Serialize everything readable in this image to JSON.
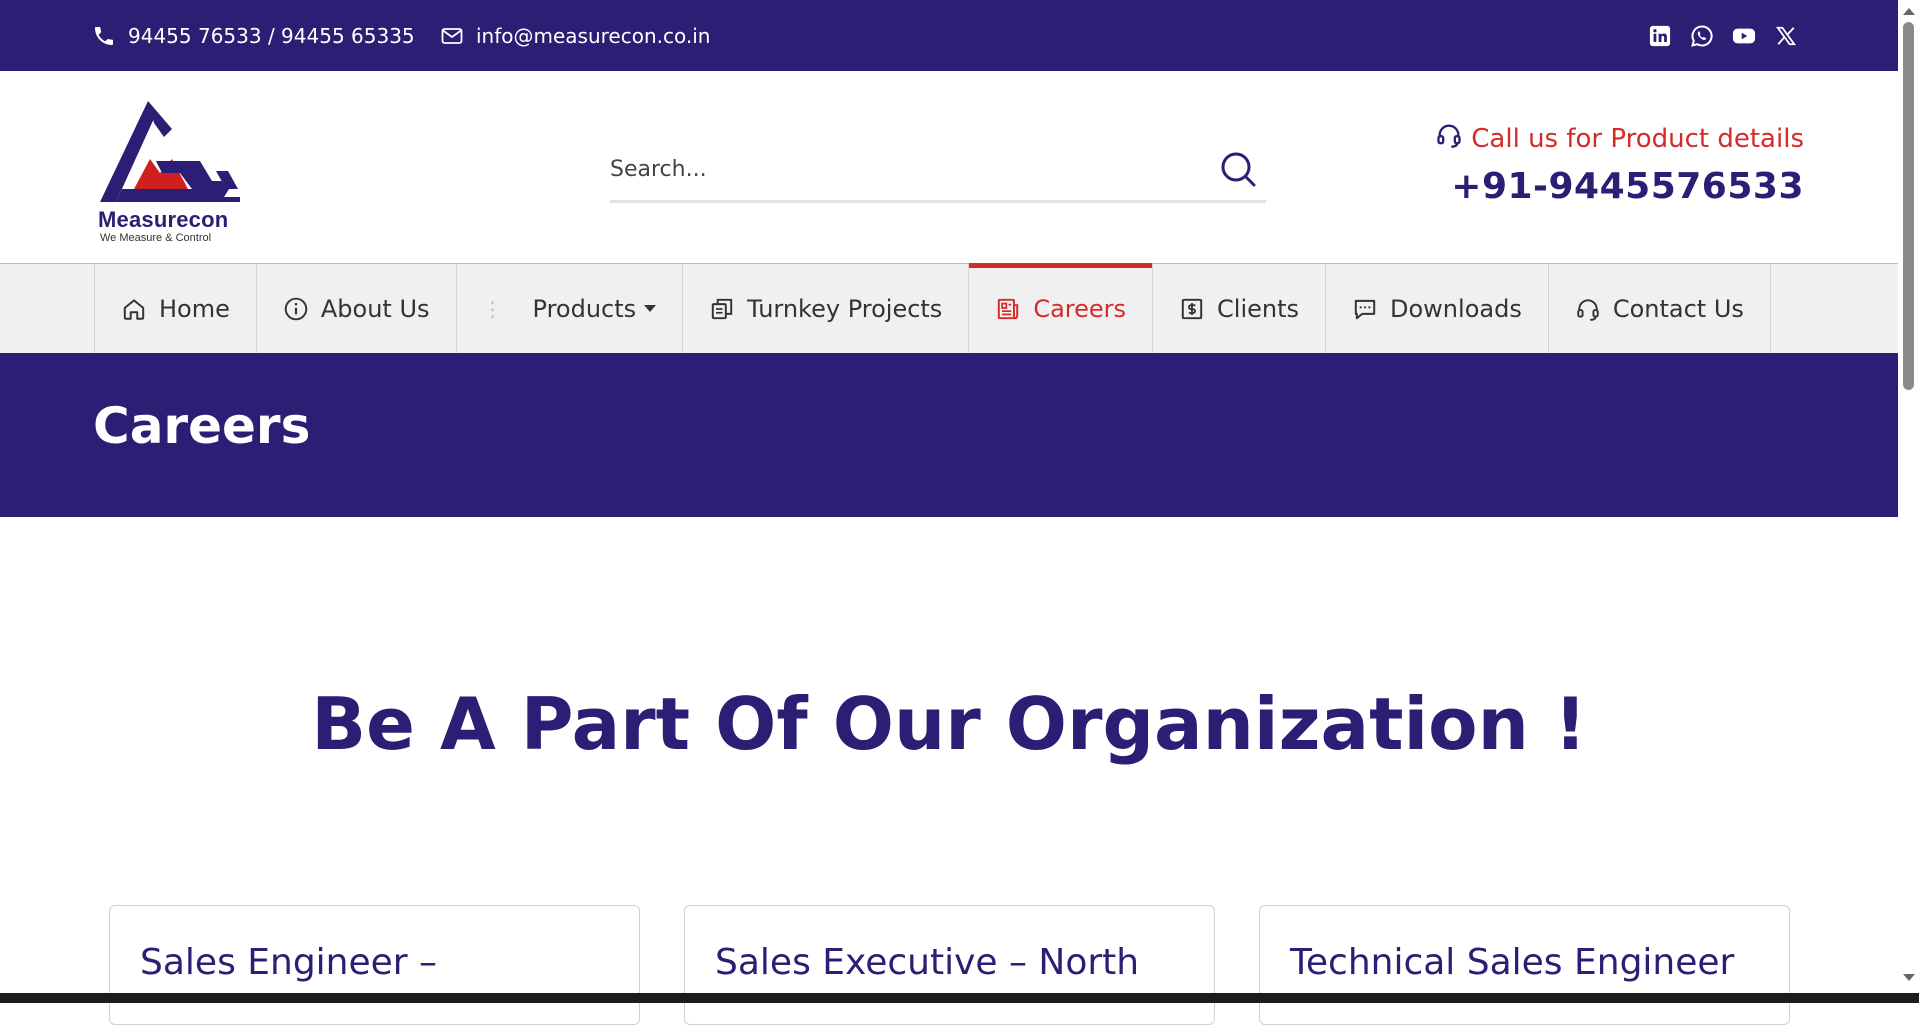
{
  "topbar": {
    "phone": "94455 76533 / 94455 65335",
    "email": "info@measurecon.co.in",
    "socials": [
      "linkedin-icon",
      "whatsapp-icon",
      "youtube-icon",
      "x-icon"
    ]
  },
  "logo": {
    "name": "Measurecon",
    "tagline": "We Measure & Control"
  },
  "search": {
    "placeholder": "Search..."
  },
  "callus": {
    "label": "Call us for Product details",
    "number": "+91-9445576533"
  },
  "nav": {
    "items": [
      {
        "label": "Home",
        "icon": "home-icon"
      },
      {
        "label": "About Us",
        "icon": "info-icon"
      },
      {
        "label": "Products",
        "icon": "dots-icon"
      },
      {
        "label": "Turnkey Projects",
        "icon": "copy-icon"
      },
      {
        "label": "Careers",
        "icon": "newspaper-icon",
        "active": true
      },
      {
        "label": "Clients",
        "icon": "dollar-box-icon"
      },
      {
        "label": "Downloads",
        "icon": "chat-icon"
      },
      {
        "label": "Contact Us",
        "icon": "headset-icon"
      }
    ]
  },
  "banner": {
    "title": "Careers"
  },
  "main": {
    "heading": "Be A Part Of Our Organization !",
    "jobs": [
      {
        "title": "Sales Engineer –"
      },
      {
        "title": "Sales Executive – North"
      },
      {
        "title": "Technical Sales Engineer"
      }
    ]
  },
  "colors": {
    "brand": "#2b1e74",
    "accent": "#d52a2a",
    "nav_bg": "#f0f0f0"
  }
}
